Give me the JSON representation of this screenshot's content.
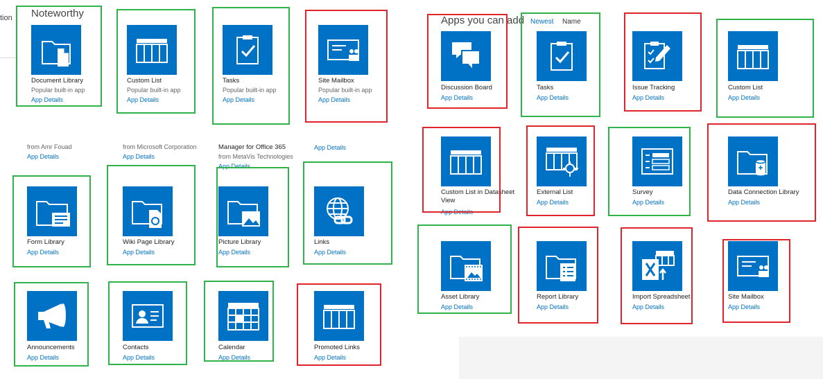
{
  "edge": {
    "text": "tion"
  },
  "left_panel": {
    "title": "Noteworthy",
    "tile_caption": "Popular built-in app",
    "featured": [
      {
        "name": "Document Library",
        "link": "App Details",
        "icon": "document-library-icon"
      },
      {
        "name": "Custom List",
        "link": "App Details",
        "icon": "custom-list-icon"
      },
      {
        "name": "Tasks",
        "link": "App Details",
        "icon": "tasks-icon"
      },
      {
        "name": "Site Mailbox",
        "link": "App Details",
        "icon": "site-mailbox-icon"
      }
    ],
    "store_apps": [
      {
        "name": "",
        "from": "from Amr Fouad",
        "link": "App Details"
      },
      {
        "name": "",
        "from": "from Microsoft Corporation",
        "link": "App Details"
      },
      {
        "name": "Manager for Office 365",
        "from": "from MetaVis Technologies",
        "link": "App Details"
      },
      {
        "name": "",
        "from": "",
        "link": "App Details"
      }
    ],
    "apps": [
      {
        "name": "Form Library",
        "link": "App Details",
        "icon": "form-library-icon"
      },
      {
        "name": "Wiki Page Library",
        "link": "App Details",
        "icon": "wiki-page-library-icon"
      },
      {
        "name": "Picture Library",
        "link": "App Details",
        "icon": "picture-library-icon"
      },
      {
        "name": "Links",
        "link": "App Details",
        "icon": "links-icon"
      },
      {
        "name": "Announcements",
        "link": "App Details",
        "icon": "announcements-icon"
      },
      {
        "name": "Contacts",
        "link": "App Details",
        "icon": "contacts-icon"
      },
      {
        "name": "Calendar",
        "link": "App Details",
        "icon": "calendar-icon"
      },
      {
        "name": "Promoted Links",
        "link": "App Details",
        "icon": "promoted-links-icon"
      }
    ]
  },
  "right_panel": {
    "title": "Apps you can add",
    "sort_newest": "Newest",
    "sort_name": "Name",
    "apps": [
      {
        "name": "Discussion Board",
        "link": "App Details",
        "icon": "discussion-board-icon"
      },
      {
        "name": "Tasks",
        "link": "App Details",
        "icon": "tasks-icon"
      },
      {
        "name": "Issue Tracking",
        "link": "App Details",
        "icon": "issue-tracking-icon"
      },
      {
        "name": "Custom List",
        "link": "App Details",
        "icon": "custom-list-icon"
      },
      {
        "name": "Custom List in Datasheet View",
        "link": "App Details",
        "icon": "custom-list-datasheet-icon"
      },
      {
        "name": "External List",
        "link": "App Details",
        "icon": "external-list-icon"
      },
      {
        "name": "Survey",
        "link": "App Details",
        "icon": "survey-icon"
      },
      {
        "name": "Data Connection Library",
        "link": "App Details",
        "icon": "data-connection-library-icon"
      },
      {
        "name": "Asset Library",
        "link": "App Details",
        "icon": "asset-library-icon"
      },
      {
        "name": "Report Library",
        "link": "App Details",
        "icon": "report-library-icon"
      },
      {
        "name": "Import Spreadsheet",
        "link": "App Details",
        "icon": "import-spreadsheet-icon"
      },
      {
        "name": "Site Mailbox",
        "link": "App Details",
        "icon": "site-mailbox-icon"
      }
    ]
  },
  "colors": {
    "tile": "#0072c6",
    "link": "#0072c6",
    "highlight_green": "#2fb24a",
    "highlight_red": "#e0242b"
  }
}
